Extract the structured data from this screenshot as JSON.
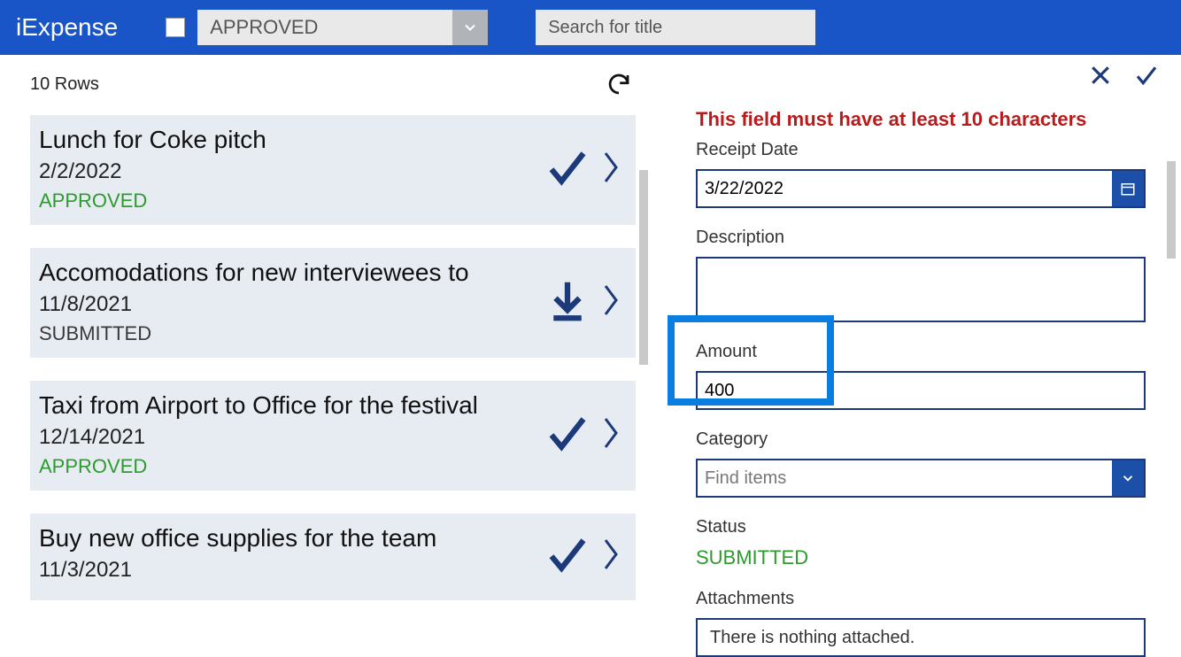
{
  "header": {
    "app_title": "iExpense",
    "filter_value": "APPROVED",
    "search_placeholder": "Search for title"
  },
  "list": {
    "count_label": "10 Rows",
    "items": [
      {
        "title": "Lunch for Coke pitch",
        "date": "2/2/2022",
        "status": "APPROVED",
        "status_class": "status-approved",
        "icon": "check"
      },
      {
        "title": "Accomodations for new interviewees to",
        "date": "11/8/2021",
        "status": "SUBMITTED",
        "status_class": "status-submitted",
        "icon": "download"
      },
      {
        "title": "Taxi from Airport to Office for the festival",
        "date": "12/14/2021",
        "status": "APPROVED",
        "status_class": "status-approved",
        "icon": "check"
      },
      {
        "title": "Buy new office supplies for the team",
        "date": "11/3/2021",
        "status": "",
        "status_class": "",
        "icon": "check"
      }
    ]
  },
  "form": {
    "error": "This field must have at least 10 characters",
    "receipt_date_label": "Receipt Date",
    "receipt_date_value": "3/22/2022",
    "description_label": "Description",
    "description_value": "",
    "amount_label": "Amount",
    "amount_value": "400",
    "category_label": "Category",
    "category_placeholder": "Find items",
    "status_label": "Status",
    "status_value": "SUBMITTED",
    "attachments_label": "Attachments",
    "attachments_empty": "There is nothing attached."
  }
}
